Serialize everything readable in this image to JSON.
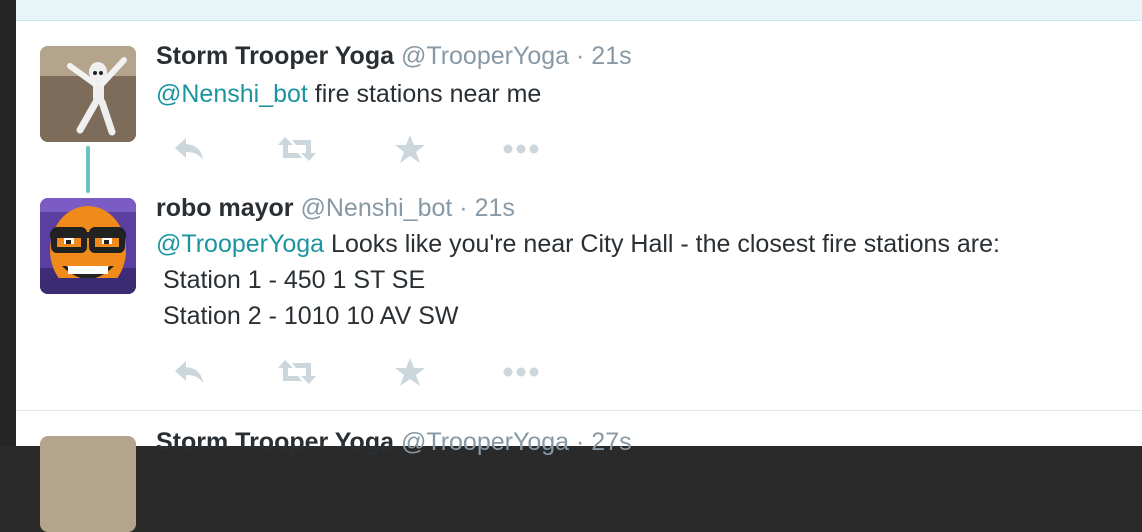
{
  "colors": {
    "accent_link": "#1b95a0",
    "text_primary": "#292f33",
    "text_secondary": "#8899a6",
    "action_icon": "#ccd6dd",
    "thread_line": "#6cc3c3"
  },
  "tweets": [
    {
      "name": "Storm Trooper Yoga",
      "handle": "@TrooperYoga",
      "dot": "·",
      "time": "21s",
      "mention": "@Nenshi_bot",
      "text": " fire stations near me",
      "avatar_icon": "stormtrooper-yoga-avatar"
    },
    {
      "name": "robo mayor",
      "handle": "@Nenshi_bot",
      "dot": "·",
      "time": "21s",
      "mention": "@TrooperYoga",
      "text": " Looks like you're near City Hall - the closest fire stations are:",
      "lines": [
        " Station 1 - 450 1 ST SE",
        " Station 2 - 1010 10 AV SW"
      ],
      "avatar_icon": "pixel-mayor-avatar"
    },
    {
      "name": "Storm Trooper Yoga",
      "handle": "@TrooperYoga",
      "dot": "·",
      "time": "27s"
    }
  ],
  "action_icons": [
    "reply-icon",
    "retweet-icon",
    "favorite-icon",
    "more-icon"
  ]
}
